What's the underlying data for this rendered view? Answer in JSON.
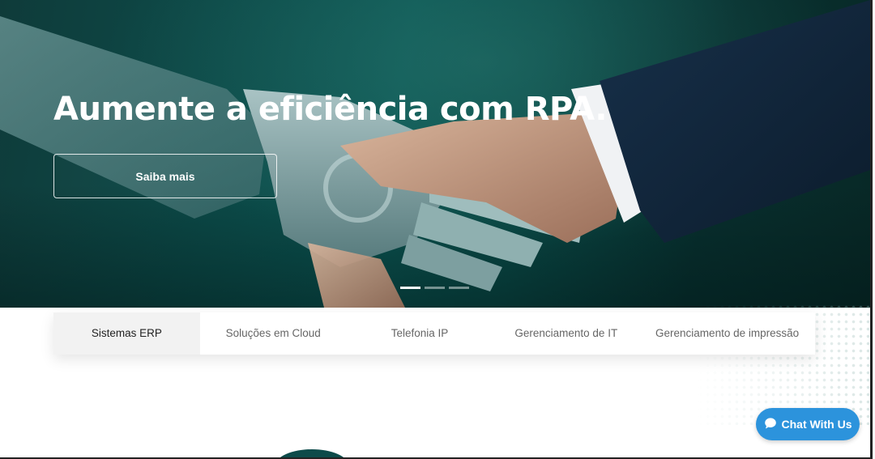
{
  "hero": {
    "title": "Aumente a eficiência com RPA.",
    "button_label": "Saiba mais",
    "slides": 3,
    "active_slide": 1
  },
  "tabs": [
    {
      "label": "Sistemas ERP",
      "active": true
    },
    {
      "label": "Soluções em Cloud",
      "active": false
    },
    {
      "label": "Telefonia IP",
      "active": false
    },
    {
      "label": "Gerenciamento de IT",
      "active": false
    },
    {
      "label": "Gerenciamento de impressão",
      "active": false
    }
  ],
  "chat": {
    "label": "Chat With Us",
    "icon": "chat-bubble-icon"
  },
  "colors": {
    "hero_bg": "#0b4a48",
    "chat_bg": "#2c93dc",
    "active_tab_bg": "#f2f2f2"
  }
}
